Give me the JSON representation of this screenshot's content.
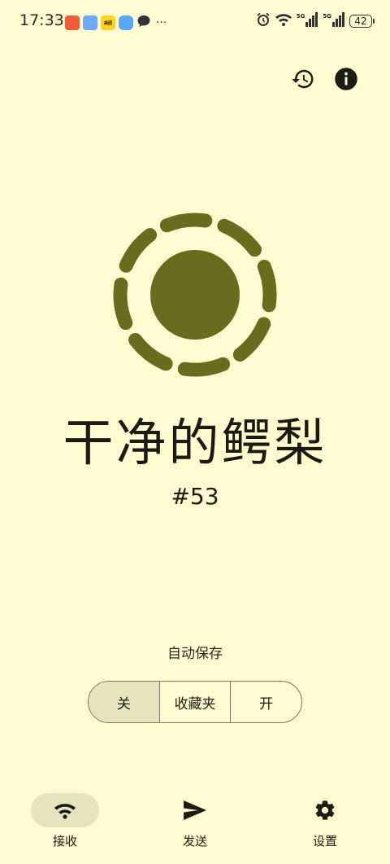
{
  "status_bar": {
    "time": "17:33",
    "notification_badges": [
      {
        "name": "pinduoduo-icon",
        "color": "#f25a3a",
        "label": ""
      },
      {
        "name": "app-store-icon",
        "color": "#6fa7f2",
        "label": ""
      },
      {
        "name": "meituan-icon",
        "color": "#ffd21e",
        "label": "美团"
      },
      {
        "name": "blue-app-icon",
        "color": "#5aa7f5",
        "label": ""
      },
      {
        "name": "message-bubble-icon",
        "color": "#333333",
        "label": ""
      }
    ],
    "more": "···",
    "network_1": "5G",
    "network_2": "5G",
    "battery": "42"
  },
  "main": {
    "name": "干净的鳄梨",
    "code": "#53",
    "emblem_color": "#6b6b1e"
  },
  "autosave": {
    "label": "自动保存",
    "options": [
      "关",
      "收藏夹",
      "开"
    ],
    "selected": "关"
  },
  "bottom_nav": {
    "items": [
      {
        "label": "接收",
        "icon": "wifi-icon",
        "active": true
      },
      {
        "label": "发送",
        "icon": "send-icon",
        "active": false
      },
      {
        "label": "设置",
        "icon": "gear-icon",
        "active": false
      }
    ]
  },
  "colors": {
    "background": "#fefbd0",
    "accent": "#6b6b1e",
    "selected_fill": "#e6e3bf"
  }
}
